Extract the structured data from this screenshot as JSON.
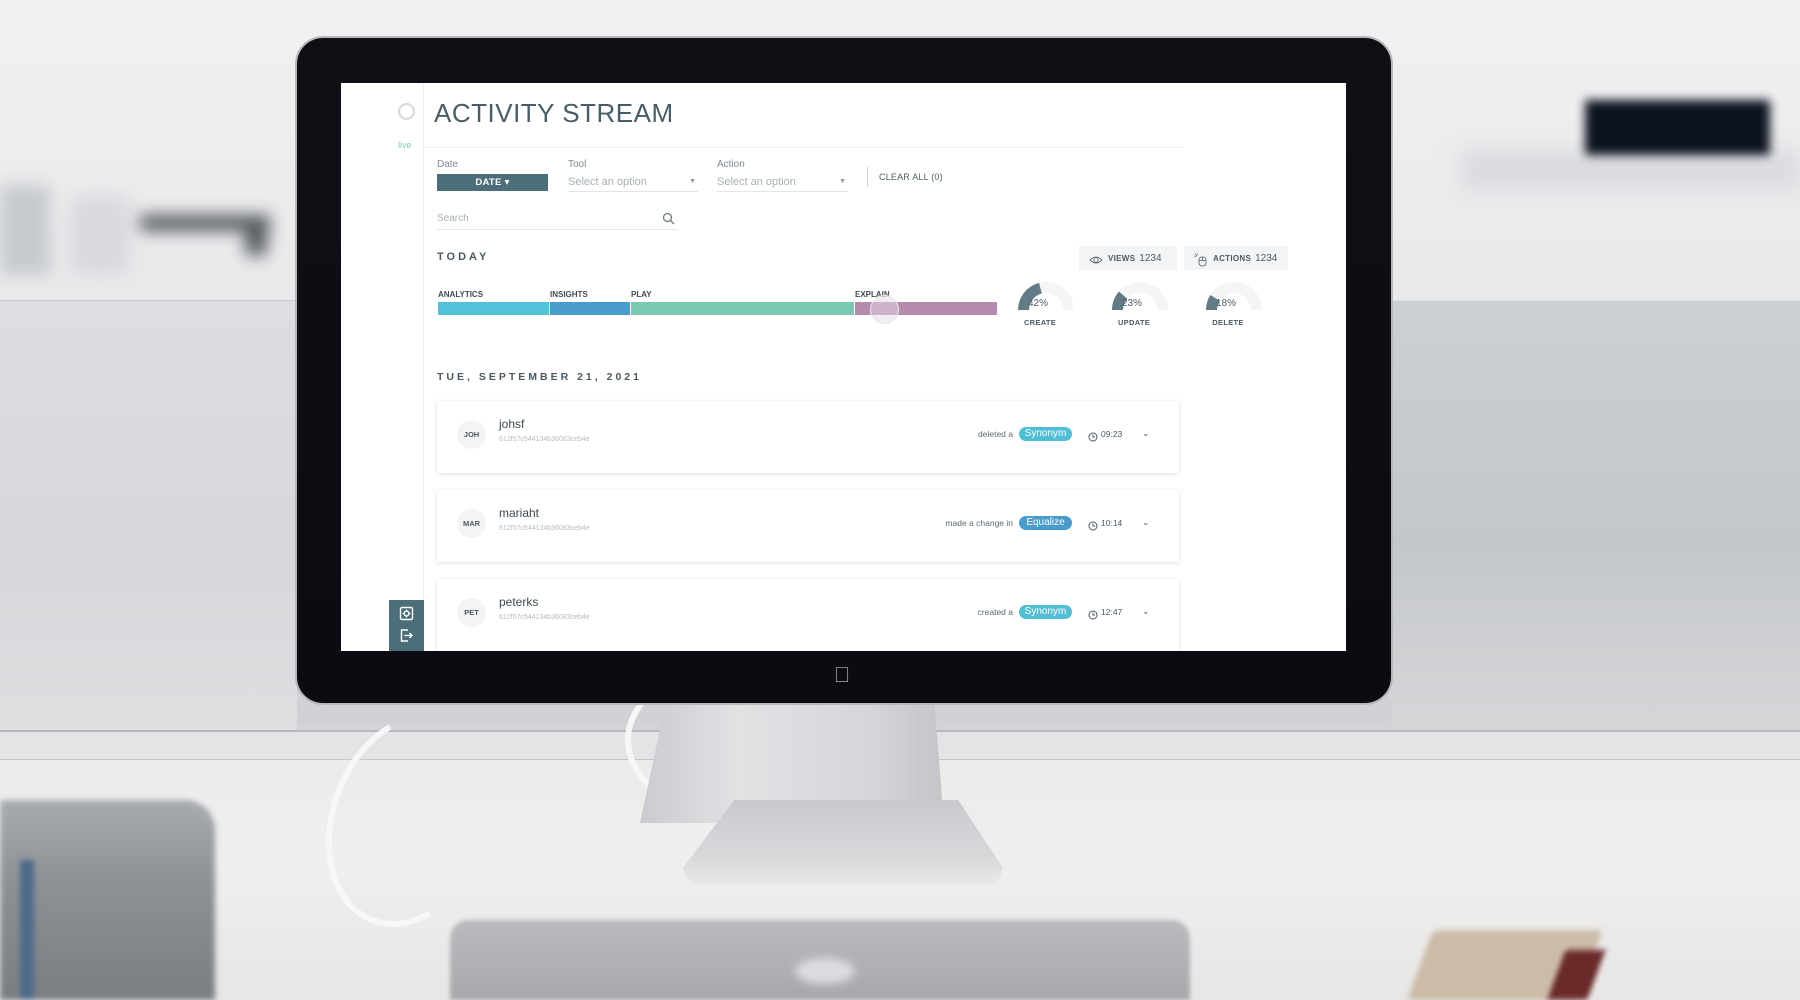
{
  "app": {
    "title": "ACTIVITY STREAM",
    "live_label": "live"
  },
  "filters": {
    "date": {
      "label": "Date",
      "button_label": "DATE ▾"
    },
    "tool": {
      "label": "Tool",
      "placeholder": "Select an option"
    },
    "action": {
      "label": "Action",
      "placeholder": "Select an option"
    },
    "clear_all_label": "CLEAR ALL (0)",
    "search_placeholder": "Search"
  },
  "today": {
    "heading": "TODAY",
    "views": {
      "label": "VIEWS",
      "value": "1234"
    },
    "actions": {
      "label": "ACTIONS",
      "value": "1234"
    },
    "tool_breakdown": [
      {
        "label": "ANALYTICS",
        "share": 0.2,
        "color": "#53c1d8"
      },
      {
        "label": "INSIGHTS",
        "share": 0.145,
        "color": "#4a9ccc"
      },
      {
        "label": "PLAY",
        "share": 0.4,
        "color": "#79c9b5"
      },
      {
        "label": "EXPLAIN",
        "share": 0.255,
        "color": "#b48aad"
      }
    ],
    "action_breakdown": [
      {
        "label": "CREATE",
        "percent": 42,
        "text": "42%"
      },
      {
        "label": "UPDATE",
        "percent": 23,
        "text": "23%"
      },
      {
        "label": "DELETE",
        "percent": 18,
        "text": "18%"
      }
    ],
    "gauge_color": "#627b86"
  },
  "stream": {
    "date_heading": "TUE, SEPTEMBER 21, 2021",
    "entries": [
      {
        "initials": "JOH",
        "user": "johsf",
        "id": "612f57c544134b36083ceb4e",
        "verb": "deleted a",
        "object": "Synonym",
        "object_color": "#4fbfd6",
        "time": "09:23"
      },
      {
        "initials": "MAR",
        "user": "mariaht",
        "id": "612f57c544134b36083ceb4e",
        "verb": "made a change in",
        "object": "Equalize",
        "object_color": "#4a9ccc",
        "time": "10:14"
      },
      {
        "initials": "PET",
        "user": "peterks",
        "id": "612f57c544134b36083ceb4e",
        "verb": "created a",
        "object": "Synonym",
        "object_color": "#4fbfd6",
        "time": "12:47"
      }
    ]
  },
  "icons": {
    "settings": "settings-icon",
    "logout": "logout-icon",
    "views": "eye-icon",
    "actions": "mouse-click-icon",
    "search": "search-icon",
    "clock": "clock-icon",
    "expand": "chevron-down-icon"
  }
}
